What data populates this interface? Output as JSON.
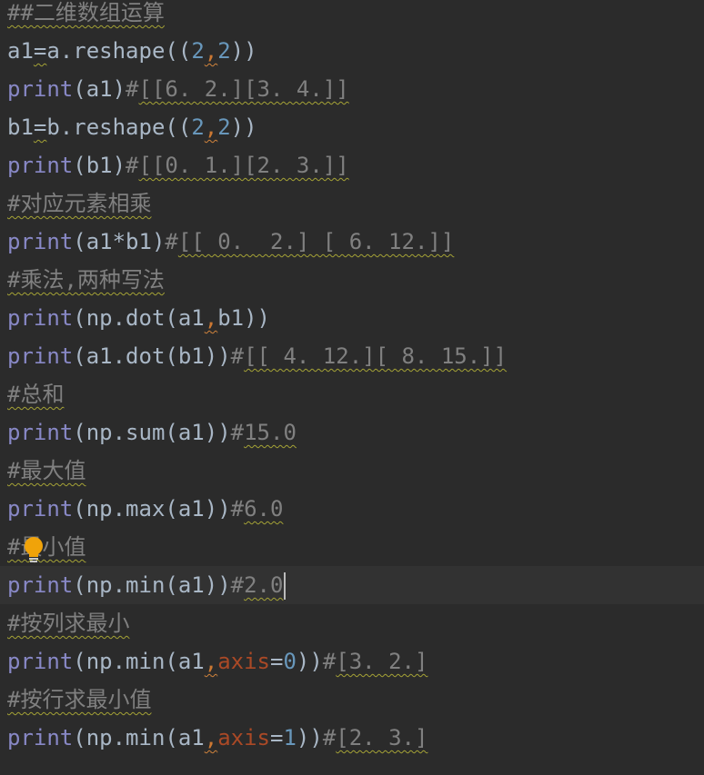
{
  "editor": {
    "lines": [
      {
        "tokens": [
          {
            "t": "##二维数组运算",
            "c": "comment",
            "sq": true
          }
        ]
      },
      {
        "tokens": [
          {
            "t": "a1",
            "c": "plain"
          },
          {
            "t": "=",
            "c": "plain",
            "sq": true
          },
          {
            "t": "a.reshape((",
            "c": "plain"
          },
          {
            "t": "2",
            "c": "number"
          },
          {
            "t": ",",
            "c": "punct",
            "sqo": true
          },
          {
            "t": "2",
            "c": "number"
          },
          {
            "t": "))",
            "c": "plain"
          }
        ]
      },
      {
        "tokens": [
          {
            "t": "print",
            "c": "builtin"
          },
          {
            "t": "(a1)",
            "c": "plain"
          },
          {
            "t": "#",
            "c": "comment"
          },
          {
            "t": "[[6. 2.][3. 4.]]",
            "c": "comment",
            "sq": true
          }
        ]
      },
      {
        "tokens": [
          {
            "t": "b1",
            "c": "plain"
          },
          {
            "t": "=",
            "c": "plain",
            "sq": true
          },
          {
            "t": "b.reshape((",
            "c": "plain"
          },
          {
            "t": "2",
            "c": "number"
          },
          {
            "t": ",",
            "c": "punct",
            "sqo": true
          },
          {
            "t": "2",
            "c": "number"
          },
          {
            "t": "))",
            "c": "plain"
          }
        ]
      },
      {
        "tokens": [
          {
            "t": "print",
            "c": "builtin"
          },
          {
            "t": "(b1)",
            "c": "plain"
          },
          {
            "t": "#",
            "c": "comment"
          },
          {
            "t": "[[0. 1.][2. 3.]]",
            "c": "comment",
            "sq": true
          }
        ]
      },
      {
        "tokens": [
          {
            "t": "#对应元素相乘",
            "c": "comment",
            "sq": true
          }
        ]
      },
      {
        "tokens": [
          {
            "t": "print",
            "c": "builtin"
          },
          {
            "t": "(a1*b1)",
            "c": "plain"
          },
          {
            "t": "#",
            "c": "comment"
          },
          {
            "t": "[[ 0.  2.] [ 6. 12.]]",
            "c": "comment",
            "sq": true
          }
        ]
      },
      {
        "tokens": [
          {
            "t": "#乘法,两种写法",
            "c": "comment",
            "sq": true
          }
        ]
      },
      {
        "tokens": [
          {
            "t": "print",
            "c": "builtin"
          },
          {
            "t": "(np.dot(a1",
            "c": "plain"
          },
          {
            "t": ",",
            "c": "punct",
            "sqo": true
          },
          {
            "t": "b1))",
            "c": "plain"
          }
        ]
      },
      {
        "tokens": [
          {
            "t": "print",
            "c": "builtin"
          },
          {
            "t": "(a1.dot(b1))",
            "c": "plain"
          },
          {
            "t": "#",
            "c": "comment"
          },
          {
            "t": "[[ 4. 12.][ 8. 15.]]",
            "c": "comment",
            "sq": true
          }
        ]
      },
      {
        "tokens": [
          {
            "t": "#总和",
            "c": "comment",
            "sq": true
          }
        ]
      },
      {
        "tokens": [
          {
            "t": "print",
            "c": "builtin"
          },
          {
            "t": "(np.sum(a1))",
            "c": "plain"
          },
          {
            "t": "#",
            "c": "comment"
          },
          {
            "t": "15.0",
            "c": "comment",
            "sq": true
          }
        ]
      },
      {
        "tokens": [
          {
            "t": "#最大值",
            "c": "comment",
            "sq": true
          }
        ]
      },
      {
        "tokens": [
          {
            "t": "print",
            "c": "builtin"
          },
          {
            "t": "(np.max(a1))",
            "c": "plain"
          },
          {
            "t": "#",
            "c": "comment"
          },
          {
            "t": "6.0",
            "c": "comment",
            "sq": true
          }
        ]
      },
      {
        "tokens": [
          {
            "t": "#最小值",
            "c": "comment",
            "sq": true
          }
        ]
      },
      {
        "current": true,
        "tokens": [
          {
            "t": "print",
            "c": "builtin"
          },
          {
            "t": "(np.min(a1))",
            "c": "plain"
          },
          {
            "t": "#",
            "c": "comment"
          },
          {
            "t": "2.0",
            "c": "comment",
            "sq": true
          }
        ]
      },
      {
        "tokens": [
          {
            "t": "#按列求最小",
            "c": "comment",
            "sq": true
          }
        ]
      },
      {
        "tokens": [
          {
            "t": "print",
            "c": "builtin"
          },
          {
            "t": "(np.min(a1",
            "c": "plain"
          },
          {
            "t": ",",
            "c": "punct",
            "sqo": true
          },
          {
            "t": "axis",
            "c": "param"
          },
          {
            "t": "=",
            "c": "plain"
          },
          {
            "t": "0",
            "c": "number"
          },
          {
            "t": "))",
            "c": "plain"
          },
          {
            "t": "#",
            "c": "comment"
          },
          {
            "t": "[3. 2.]",
            "c": "comment",
            "sq": true
          }
        ]
      },
      {
        "tokens": [
          {
            "t": "#按行求最小值",
            "c": "comment",
            "sq": true
          }
        ]
      },
      {
        "tokens": [
          {
            "t": "print",
            "c": "builtin"
          },
          {
            "t": "(np.min(a1",
            "c": "plain"
          },
          {
            "t": ",",
            "c": "punct",
            "sqo": true
          },
          {
            "t": "axis",
            "c": "param"
          },
          {
            "t": "=",
            "c": "plain"
          },
          {
            "t": "1",
            "c": "number"
          },
          {
            "t": "))",
            "c": "plain"
          },
          {
            "t": "#",
            "c": "comment"
          },
          {
            "t": "[2. 3.]",
            "c": "comment",
            "sq": true
          }
        ]
      }
    ],
    "intention_icon": "lightbulb-icon",
    "colors": {
      "background": "#2b2b2b",
      "current_line": "#323232",
      "plain": "#a9b7c6",
      "builtin": "#8888c6",
      "comment": "#808080",
      "number": "#6897bb",
      "param": "#aa4926",
      "punct": "#cc7832",
      "squiggle": "#a5a336",
      "bulb": "#f0a30a"
    }
  }
}
